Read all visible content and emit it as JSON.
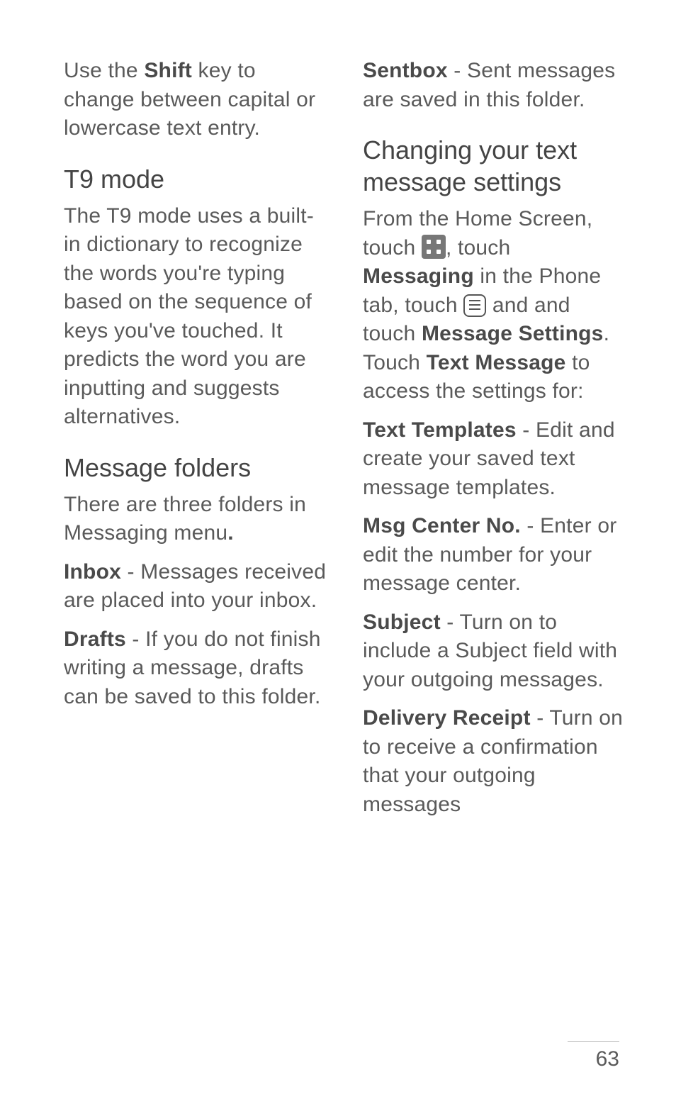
{
  "col1": {
    "p1_a": "Use the ",
    "p1_b": "Shift",
    "p1_c": " key to change between capital or lowercase text entry.",
    "h1": "T9 mode",
    "p2": "The T9 mode uses a built-in dictionary to recognize the words you're typing based on the sequence of keys you've touched. It predicts the word you are inputting and suggests alternatives.",
    "h2": "Message folders",
    "p3_a": "There are three folders in Messaging menu",
    "p3_b": ".",
    "p4_a": "Inbox",
    "p4_b": " - Messages received are placed into your inbox.",
    "p5_a": "Drafts",
    "p5_b": " - If you do not finish writing a message, drafts can be saved to this folder."
  },
  "col2": {
    "p1_a": "Sentbox",
    "p1_b": " - Sent messages are saved in this folder.",
    "h1": "Changing your text message settings",
    "p2_a": "From the Home Screen, touch ",
    "p2_b": ", touch ",
    "p2_c": "Messaging",
    "p2_d": " in the Phone tab, touch ",
    "p2_e": " and and touch ",
    "p2_f": "Message Settings",
    "p2_g": ". Touch ",
    "p2_h": "Text Message",
    "p2_i": " to access the settings for:",
    "p3_a": "Text Templates",
    "p3_b": " - Edit and create your saved text message templates.",
    "p4_a": "Msg Center No.",
    "p4_b": " - Enter or edit the number for your message center.",
    "p5_a": "Subject",
    "p5_b": " - Turn on to include a Subject field with your outgoing messages.",
    "p6_a": "Delivery Receipt",
    "p6_b": " - Turn on to receive a confirmation that your outgoing messages"
  },
  "page_number": "63"
}
